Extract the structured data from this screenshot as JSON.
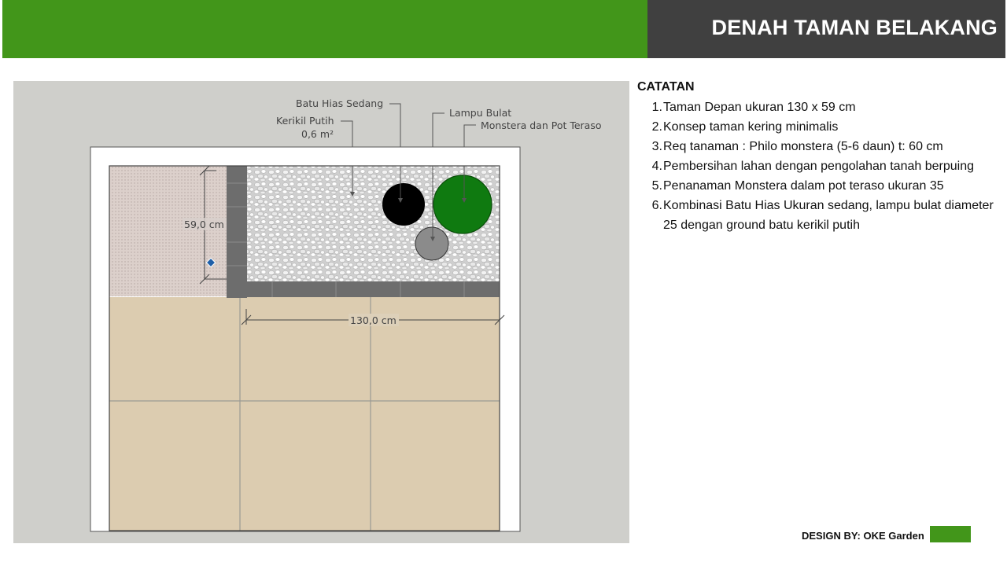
{
  "header": {
    "title": "DENAH TAMAN BELAKANG",
    "colors": {
      "green": "#42961a",
      "dark": "#404040"
    }
  },
  "plan": {
    "labels": {
      "batu_hias": "Batu Hias Sedang",
      "kerikil": "Kerikil Putih",
      "kerikil_area": "0,6 m²",
      "lampu": "Lampu Bulat",
      "monstera": "Monstera dan Pot Teraso"
    },
    "dimensions": {
      "depth": "59,0 cm",
      "width": "130,0 cm"
    },
    "colors": {
      "monstera_pot": "#0f7a10",
      "lamp": "#000000",
      "stone": "#8b8b8b",
      "tiles": "#d8c6a8",
      "paving": "#d9cbc6",
      "border": "#6e6e6e"
    }
  },
  "notes": {
    "title": "CATATAN",
    "items": [
      {
        "num": "1.",
        "text": "Taman Depan ukuran 130 x 59 cm"
      },
      {
        "num": "2.",
        "text": "Konsep taman kering minimalis"
      },
      {
        "num": "3.",
        "text": "Req tanaman : Philo monstera (5-6 daun) t: 60 cm"
      },
      {
        "num": "4.",
        "text": "Pembersihan lahan dengan pengolahan tanah berpuing"
      },
      {
        "num": "5.",
        "text": "Penanaman Monstera dalam pot teraso ukuran 35"
      },
      {
        "num": "6.",
        "text": "Kombinasi Batu Hias Ukuran sedang, lampu bulat diameter 25 dengan ground batu kerikil putih"
      }
    ]
  },
  "credit": {
    "label": "DESIGN BY: OKE Garden"
  }
}
